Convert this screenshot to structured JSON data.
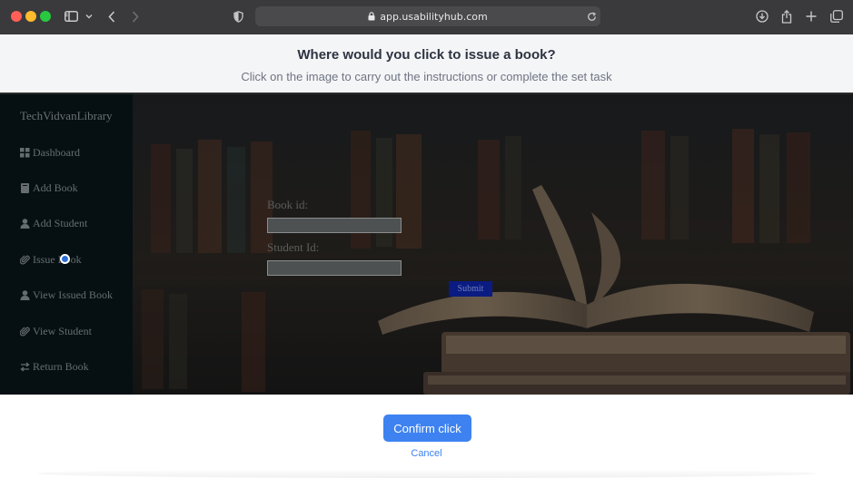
{
  "browser": {
    "url": "app.usabilityhub.com",
    "icons": [
      "sidebar-icon",
      "chevron-down-icon",
      "back-icon",
      "forward-icon",
      "shield-icon",
      "lock-icon",
      "reload-icon",
      "download-icon",
      "share-icon",
      "new-tab-icon",
      "tabs-icon"
    ]
  },
  "instructions": {
    "title": "Where would you click to issue a book?",
    "subtitle": "Click on the image to carry out the instructions or complete the set task"
  },
  "app": {
    "brand": "TechVidvanLibrary",
    "nav": [
      {
        "label": "Dashboard",
        "icon": "grid-icon"
      },
      {
        "label": "Add Book",
        "icon": "book-icon"
      },
      {
        "label": "Add Student",
        "icon": "user-icon"
      },
      {
        "label": "Issue Book",
        "icon": "paperclip-icon"
      },
      {
        "label": "View Issued Book",
        "icon": "user-icon"
      },
      {
        "label": "View Student",
        "icon": "paperclip-icon"
      },
      {
        "label": "Return Book",
        "icon": "exchange-icon"
      }
    ],
    "form": {
      "book_id_label": "Book id:",
      "book_id_value": "",
      "student_id_label": "Student Id:",
      "student_id_value": "",
      "submit_label": "Submit"
    }
  },
  "actions": {
    "confirm_label": "Confirm click",
    "cancel_label": "Cancel"
  },
  "colors": {
    "accent": "#3d82f0",
    "sidebar": "#061013",
    "submit": "#0a1b82"
  }
}
